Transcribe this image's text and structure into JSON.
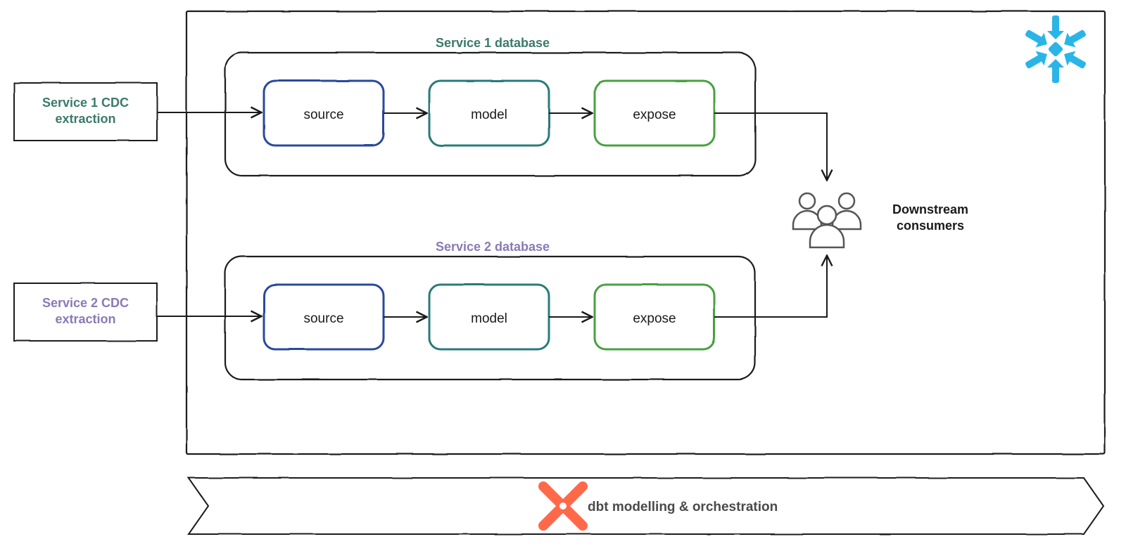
{
  "left": {
    "service1": "Service 1 CDC extraction",
    "service2": "Service 2 CDC extraction"
  },
  "databases": {
    "db1": {
      "title": "Service 1 database",
      "source": "source",
      "model": "model",
      "expose": "expose"
    },
    "db2": {
      "title": "Service 2 database",
      "source": "source",
      "model": "model",
      "expose": "expose"
    }
  },
  "consumers": "Downstream consumers",
  "footer": "dbt modelling & orchestration",
  "colors": {
    "svc1_title": "#3a7a6a",
    "svc2_title": "#8a7ab5",
    "source_box": "#2a4a9a",
    "model_box": "#2a7a7a",
    "expose_box": "#4aa040",
    "snowflake": "#29B5E8",
    "dbt": "#FF694A",
    "ink": "#1a1a1a"
  }
}
